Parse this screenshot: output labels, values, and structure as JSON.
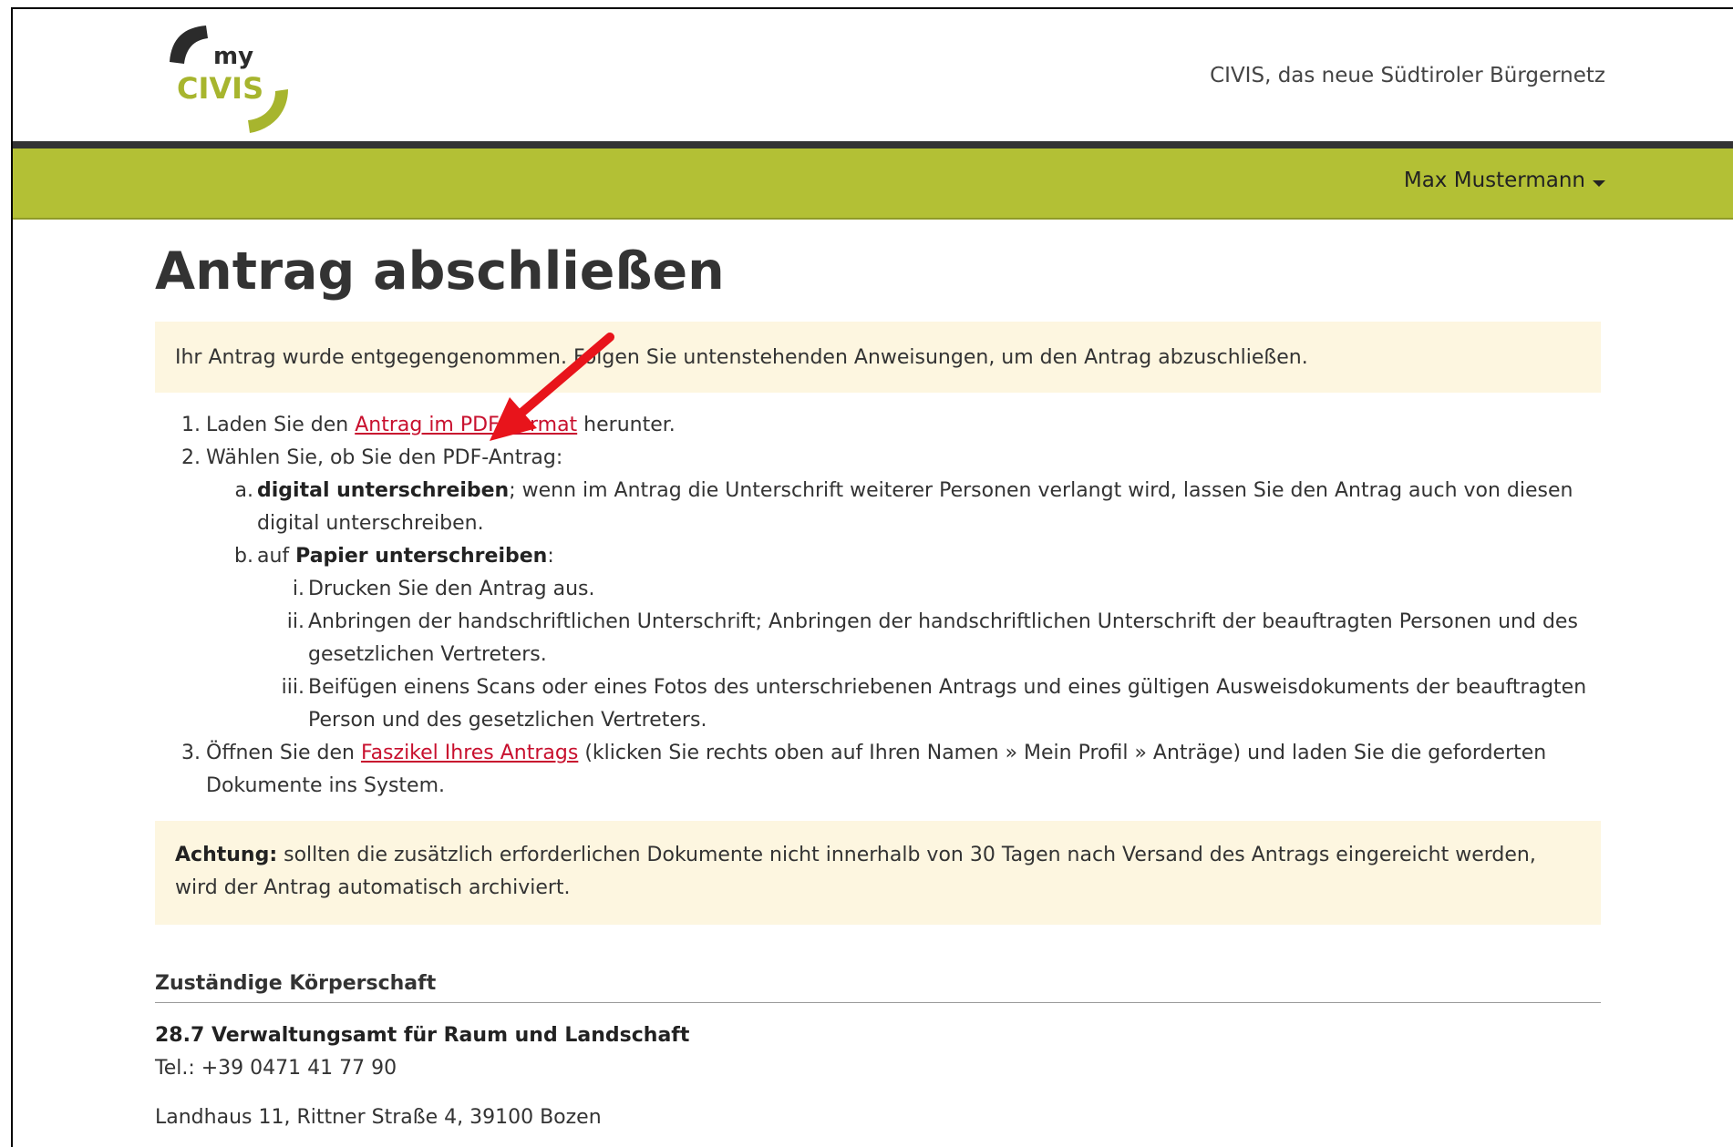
{
  "header": {
    "logo_my": "my",
    "logo_civis": "CIVIS",
    "tagline": "CIVIS, das neue Südtiroler Bürgernetz"
  },
  "nav": {
    "user_name": "Max Mustermann"
  },
  "page": {
    "title": "Antrag abschließen",
    "notice": "Ihr Antrag wurde entgegengenommen. Folgen Sie untenstehenden Anweisungen, um den Antrag abzuschließen."
  },
  "steps": {
    "s1": {
      "num": "1.",
      "pre": "Laden Sie den ",
      "link": "Antrag im PDF-Format",
      "post": " herunter."
    },
    "s2": {
      "num": "2.",
      "text": "Wählen Sie, ob Sie den PDF-Antrag:"
    },
    "s2a": {
      "num": "a.",
      "bold": "digital unterschreiben",
      "text": "; wenn im Antrag die Unterschrift weiterer Personen verlangt wird, lassen Sie den Antrag auch von diesen digital unterschreiben."
    },
    "s2b": {
      "num": "b.",
      "pre": "auf ",
      "bold": "Papier unterschreiben",
      "post": ":"
    },
    "s2bi": {
      "num": "i.",
      "text": "Drucken Sie den Antrag aus."
    },
    "s2bii": {
      "num": "ii.",
      "text": "Anbringen der handschriftlichen Unterschrift; Anbringen der handschriftlichen Unterschrift der beauftragten Personen und des gesetzlichen Vertreters."
    },
    "s2biii": {
      "num": "iii.",
      "text": "Beifügen einens Scans oder eines Fotos des unterschriebenen Antrags und eines gültigen Ausweisdokuments der beauftragten Person und des gesetzlichen Vertreters."
    },
    "s3": {
      "num": "3.",
      "pre": "Öffnen Sie den ",
      "link": "Faszikel Ihres Antrags",
      "post": " (klicken Sie rechts oben auf Ihren Namen  »  Mein Profil  »  Anträge) und laden Sie die geforderten Dokumente ins System."
    }
  },
  "warning": {
    "label": "Achtung:",
    "text": " sollten die zusätzlich erforderlichen Dokumente nicht innerhalb von 30 Tagen nach Versand des Antrags eingereicht werden, wird der Antrag automatisch archiviert."
  },
  "authority": {
    "heading": "Zuständige Körperschaft",
    "name": "28.7 Verwaltungsamt für Raum und Landschaft",
    "phone": "Tel.: +39 0471 41 77 90",
    "address": "Landhaus 11, Rittner Straße 4, 39100 Bozen"
  },
  "colors": {
    "accent_green": "#b3c035",
    "dark_bar": "#333333",
    "notice_bg": "#fdf6e0",
    "link": "#c8102e",
    "annotation_arrow": "#e8141b"
  }
}
